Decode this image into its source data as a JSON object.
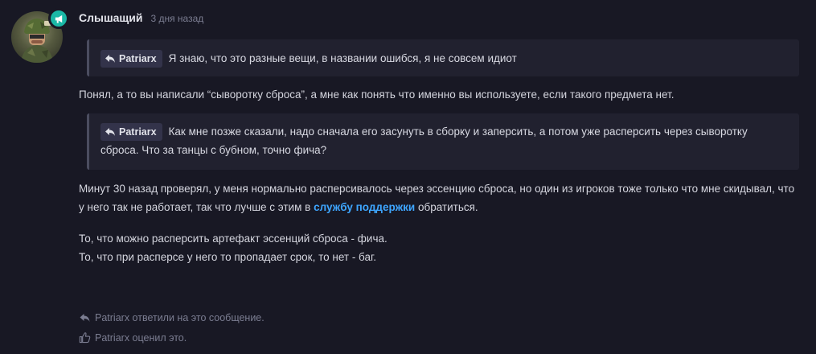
{
  "post": {
    "author": "Слышащий",
    "time": "3 дня назад",
    "avatar_icon": "soldier-avatar",
    "badge_icon": "megaphone-icon",
    "quote1": {
      "author": "Patriarx",
      "text": "Я знаю, что это разные вещи, в названии ошибся, я не совсем идиот"
    },
    "para1": "Понял, а то вы написали “сыворотку сброса”, а мне как понять что именно вы используете, если такого предмета нет.",
    "quote2": {
      "author": "Patriarx",
      "text": "Как мне позже сказали, надо сначала его засунуть в сборку и заперсить, а потом уже расперсить через сыворотку сброса. Что за танцы с бубном, точно фича?"
    },
    "para2_before": "Минут 30 назад проверял, у меня нормально расперсивалось через эссенцию сброса, но один из игроков тоже только что мне скидывал, что у него так не работает, так что лучше с этим в ",
    "para2_link": "службу поддержки",
    "para2_after": " обратиться.",
    "para3_line1": "То, что можно расперсить артефакт эссенций сброса - фича.",
    "para3_line2": "То, что при расперсе у него то пропадает срок, то нет - баг."
  },
  "footer": {
    "replied": "Patriarx ответили на это сообщение.",
    "replied_icon": "reply-icon",
    "liked": "Patriarx оценил это.",
    "liked_icon": "thumbs-up-icon"
  },
  "colors": {
    "background": "#181824",
    "quote_bg": "#21212f",
    "link": "#3ea6ff",
    "badge": "#1ab8a6"
  }
}
